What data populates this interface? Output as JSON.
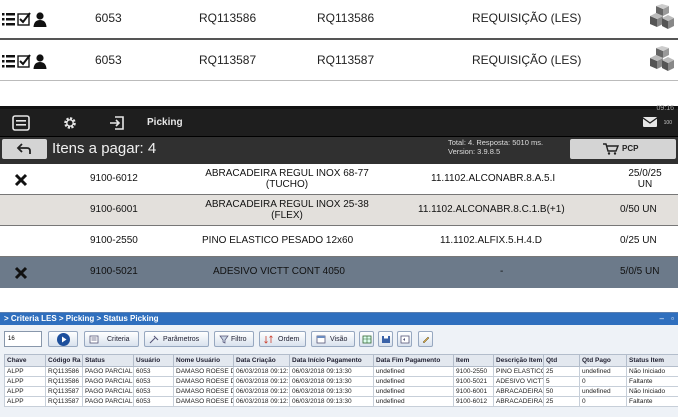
{
  "requisitions": [
    {
      "number": "6053",
      "code1": "RQ113586",
      "code2": "RQ113586",
      "type": "REQUISIÇÃO (LES)"
    },
    {
      "number": "6053",
      "code1": "RQ113587",
      "code2": "RQ113587",
      "type": "REQUISIÇÃO (LES)"
    }
  ],
  "picking": {
    "title": "Picking",
    "clock": "09:16",
    "mail_badge": "100",
    "items_title": "Itens a pagar: 4",
    "stats_total": "Total: 4. Resposta: 5010 ms.",
    "stats_version": "Version: 3.9.8.5",
    "pcp_label": "PCP",
    "rows": [
      {
        "marked": true,
        "code": "9100-6012",
        "desc1": "ABRACADEIRA REGUL INOX  68-77",
        "desc2": "(TUCHO)",
        "location": "11.1102.ALCONABR.8.A.5.I",
        "qty1": "25/0/25",
        "qty2": "UN"
      },
      {
        "marked": false,
        "code": "9100-6001",
        "desc1": "ABRACADEIRA REGUL INOX  25-38",
        "desc2": "(FLEX)",
        "location": "11.1102.ALCONABR.8.C.1.B(+1)",
        "qty1": "0/50 UN",
        "qty2": ""
      },
      {
        "marked": false,
        "code": "9100-2550",
        "desc1": "PINO ELASTICO PESADO 12x60",
        "desc2": "",
        "location": "11.1102.ALFIX.5.H.4.D",
        "qty1": "0/25 UN",
        "qty2": ""
      },
      {
        "marked": true,
        "code": "9100-5021",
        "desc1": "ADESIVO VICTT CONT 4050",
        "desc2": "",
        "location": "-",
        "qty1": "5/0/5 UN",
        "qty2": ""
      }
    ]
  },
  "status_picking": {
    "breadcrumb": "> Criteria LES > Picking > Status Picking",
    "page_size": "16",
    "toolbar": {
      "criteria": "Criteria",
      "parametros": "Parâmetros",
      "filtro": "Filtro",
      "ordem": "Ordem",
      "visao": "Visão"
    },
    "columns": [
      "Chave",
      "Código Ra",
      "Status",
      "Usuário",
      "Nome Usuário",
      "Data Criação",
      "Data Início Pagamento",
      "Data Fim Pagamento",
      "Item",
      "Descrição Item",
      "Qtd",
      "Qtd Pago",
      "Status Item"
    ],
    "rows": [
      [
        "ALPP",
        "RQ113586",
        "PAGO PARCIAL",
        "6053",
        "DAMASO ROESE DA",
        "06/03/2018 09:12:",
        "06/03/2018 09:13:30",
        "undefined",
        "9100-2550",
        "PINO ELASTICO PESA",
        "25",
        "undefined",
        "Não Iniciado"
      ],
      [
        "ALPP",
        "RQ113586",
        "PAGO PARCIAL",
        "6053",
        "DAMASO ROESE DA",
        "06/03/2018 09:12:",
        "06/03/2018 09:13:30",
        "undefined",
        "9100-5021",
        "ADESIVO VICTT CON",
        "5",
        "0",
        "Faltante"
      ],
      [
        "ALPP",
        "RQ113587",
        "PAGO PARCIAL",
        "6053",
        "DAMASO ROESE DA",
        "06/03/2018 09:12:",
        "06/03/2018 09:13:30",
        "undefined",
        "9100-6001",
        "ABRACADEIRA REGUL",
        "50",
        "undefined",
        "Não Iniciado"
      ],
      [
        "ALPP",
        "RQ113587",
        "PAGO PARCIAL",
        "6053",
        "DAMASO ROESE DA",
        "06/03/2018 09:12:",
        "06/03/2018 09:13:30",
        "undefined",
        "9100-6012",
        "ABRACADEIRA REGUL",
        "25",
        "0",
        "Faltante"
      ]
    ]
  }
}
